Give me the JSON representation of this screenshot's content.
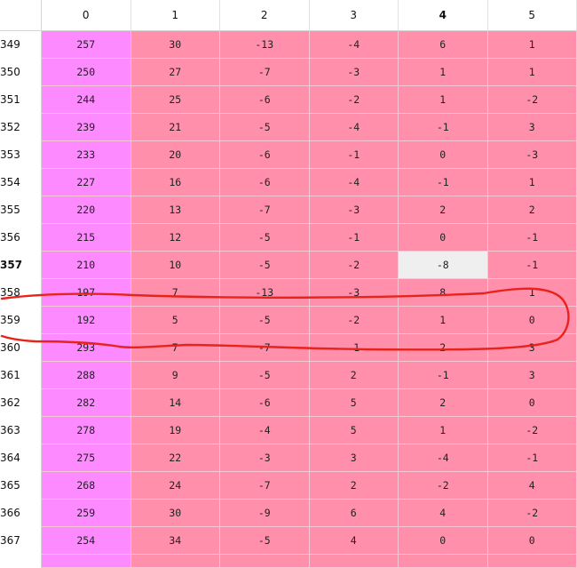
{
  "columns": [
    "0",
    "1",
    "2",
    "3",
    "4",
    "5"
  ],
  "rows": [
    {
      "index": "349",
      "values": [
        "257",
        "30",
        "-13",
        "-4",
        "6",
        "1"
      ]
    },
    {
      "index": "350",
      "values": [
        "250",
        "27",
        "-7",
        "-3",
        "1",
        "1"
      ]
    },
    {
      "index": "351",
      "values": [
        "244",
        "25",
        "-6",
        "-2",
        "1",
        "-2"
      ]
    },
    {
      "index": "352",
      "values": [
        "239",
        "21",
        "-5",
        "-4",
        "-1",
        "3"
      ]
    },
    {
      "index": "353",
      "values": [
        "233",
        "20",
        "-6",
        "-1",
        "0",
        "-3"
      ]
    },
    {
      "index": "354",
      "values": [
        "227",
        "16",
        "-6",
        "-4",
        "-1",
        "1"
      ]
    },
    {
      "index": "355",
      "values": [
        "220",
        "13",
        "-7",
        "-3",
        "2",
        "2"
      ]
    },
    {
      "index": "356",
      "values": [
        "215",
        "12",
        "-5",
        "-1",
        "0",
        "-1"
      ]
    },
    {
      "index": "357",
      "values": [
        "210",
        "10",
        "-5",
        "-2",
        "-8",
        "-1"
      ]
    },
    {
      "index": "358",
      "values": [
        "197",
        "7",
        "-13",
        "-3",
        "8",
        "1"
      ]
    },
    {
      "index": "359",
      "values": [
        "192",
        "5",
        "-5",
        "-2",
        "1",
        "0"
      ]
    },
    {
      "index": "360",
      "values": [
        "293",
        "7",
        "-7",
        "-1",
        "2",
        "3"
      ]
    },
    {
      "index": "361",
      "values": [
        "288",
        "9",
        "-5",
        "2",
        "-1",
        "3"
      ]
    },
    {
      "index": "362",
      "values": [
        "282",
        "14",
        "-6",
        "5",
        "2",
        "0"
      ]
    },
    {
      "index": "363",
      "values": [
        "278",
        "19",
        "-4",
        "5",
        "1",
        "-2"
      ]
    },
    {
      "index": "364",
      "values": [
        "275",
        "22",
        "-3",
        "3",
        "-4",
        "-1"
      ]
    },
    {
      "index": "365",
      "values": [
        "268",
        "24",
        "-7",
        "2",
        "-2",
        "4"
      ]
    },
    {
      "index": "366",
      "values": [
        "259",
        "30",
        "-9",
        "6",
        "4",
        "-2"
      ]
    },
    {
      "index": "367",
      "values": [
        "254",
        "34",
        "-5",
        "4",
        "0",
        "0"
      ]
    }
  ],
  "selection": {
    "row": "357",
    "column": "4"
  },
  "colors": {
    "column0_bg": "#fd8bff",
    "cell_bg": "#ff8fab",
    "selected_bg": "#efefef",
    "annotation": "#e8231c"
  }
}
